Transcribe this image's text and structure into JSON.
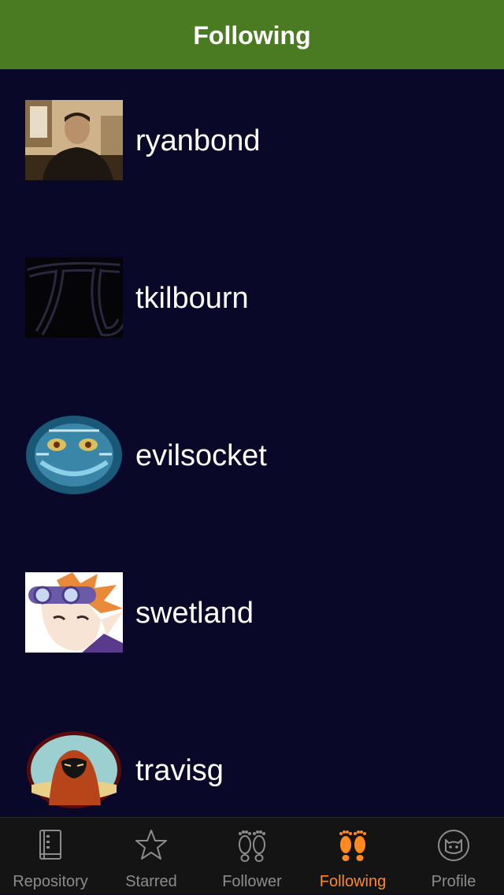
{
  "nav": {
    "title": "Following"
  },
  "users": [
    {
      "username": "ryanbond"
    },
    {
      "username": "tkilbourn"
    },
    {
      "username": "evilsocket"
    },
    {
      "username": "swetland"
    },
    {
      "username": "travisg"
    }
  ],
  "tabbar": {
    "tabs": [
      {
        "label": "Repository",
        "icon": "book-icon"
      },
      {
        "label": "Starred",
        "icon": "star-icon"
      },
      {
        "label": "Follower",
        "icon": "footprints-icon"
      },
      {
        "label": "Following",
        "icon": "footprints-icon",
        "active": true
      },
      {
        "label": "Profile",
        "icon": "octocat-icon"
      }
    ]
  },
  "colors": {
    "nav_bg": "#4a7a22",
    "list_bg": "#0a0828",
    "tab_active": "#ff8a1f",
    "tab_inactive": "#8c8c8c"
  }
}
